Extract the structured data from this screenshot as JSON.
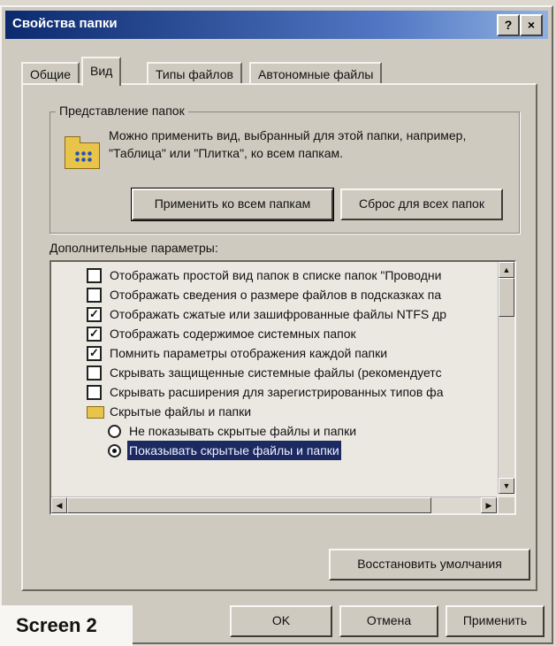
{
  "window": {
    "title": "Свойства папки",
    "help_glyph": "?",
    "close_glyph": "×"
  },
  "tabs": [
    {
      "label": "Общие",
      "active": false
    },
    {
      "label": "Вид",
      "active": true
    },
    {
      "label": "Типы файлов",
      "active": false
    },
    {
      "label": "Автономные файлы",
      "active": false
    }
  ],
  "folder_view": {
    "legend": "Представление папок",
    "description": "Можно применить вид, выбранный для этой папки, например, \"Таблица\" или \"Плитка\", ко всем папкам.",
    "apply_all_label": "Применить ко всем папкам",
    "reset_all_label": "Сброс для всех папок"
  },
  "advanced": {
    "label": "Дополнительные параметры:",
    "items": [
      {
        "type": "checkbox",
        "checked": false,
        "text": "Отображать простой вид папок в списке папок \"Проводни"
      },
      {
        "type": "checkbox",
        "checked": false,
        "text": "Отображать сведения о размере файлов в подсказках па"
      },
      {
        "type": "checkbox",
        "checked": true,
        "text": "Отображать сжатые или зашифрованные файлы NTFS др"
      },
      {
        "type": "checkbox",
        "checked": true,
        "text": "Отображать содержимое системных папок"
      },
      {
        "type": "checkbox",
        "checked": true,
        "text": "Помнить параметры отображения каждой папки"
      },
      {
        "type": "checkbox",
        "checked": false,
        "text": "Скрывать защищенные системные файлы (рекомендуетс"
      },
      {
        "type": "checkbox",
        "checked": false,
        "text": "Скрывать расширения для зарегистрированных типов фа"
      },
      {
        "type": "folder",
        "text": "Скрытые файлы и папки"
      },
      {
        "type": "radio",
        "checked": false,
        "text": "Не показывать скрытые файлы и папки"
      },
      {
        "type": "radio",
        "checked": true,
        "selected": true,
        "text": "Показывать скрытые файлы и папки"
      }
    ],
    "check_glyph": "✓",
    "restore_label": "Восстановить умолчания"
  },
  "footer": {
    "ok_label": "OK",
    "cancel_label": "Отмена",
    "apply_label": "Применить"
  },
  "caption": "Screen 2",
  "colors": {
    "titlebar_dark": "#0b2a6e",
    "titlebar_light": "#8fb0e0",
    "selection": "#1b2a60",
    "window_face": "#cfcac0"
  }
}
